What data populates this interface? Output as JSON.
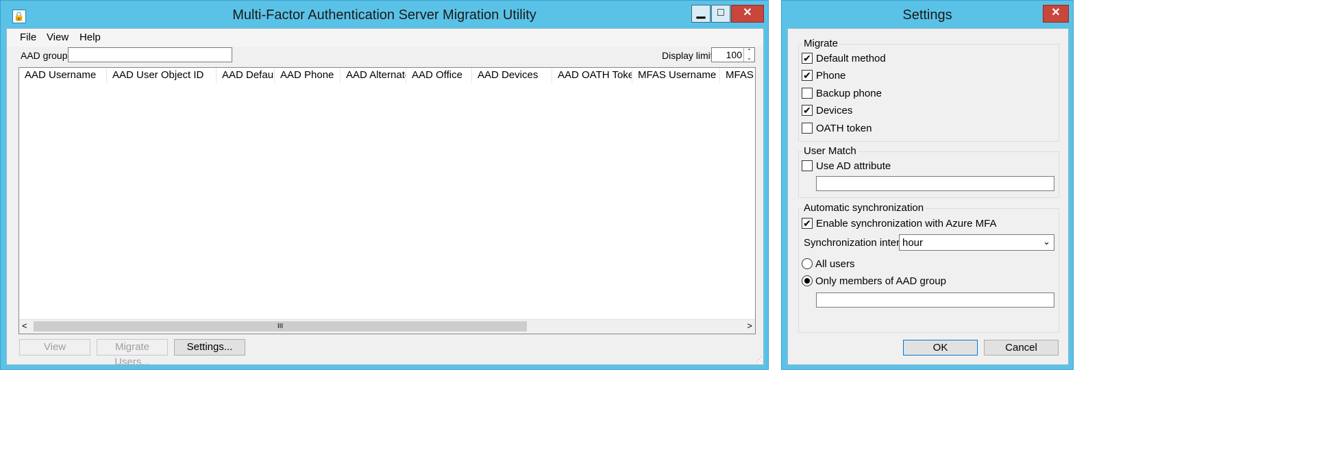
{
  "main_window": {
    "title": "Multi-Factor Authentication Server Migration Utility",
    "controls": {
      "minimize": "▁",
      "maximize": "□",
      "close": "✕"
    },
    "menu": [
      "File",
      "View",
      "Help"
    ],
    "aad_group_label": "AAD group:",
    "aad_group_value": "",
    "display_limit_label": "Display limit:",
    "display_limit_value": "100",
    "columns": [
      "AAD Username",
      "AAD User Object ID",
      "AAD Default",
      "AAD Phone",
      "AAD Alternate",
      "AAD Office",
      "AAD Devices",
      "AAD OATH Token",
      "MFAS Username",
      "MFAS D"
    ],
    "scrollbar": {
      "left": "<",
      "thumb": "III",
      "right": ">"
    },
    "buttons": {
      "view": "View",
      "migrate": "Migrate Users...",
      "settings": "Settings..."
    }
  },
  "settings_window": {
    "title": "Settings",
    "close": "✕",
    "migrate": {
      "title": "Migrate",
      "options": [
        {
          "label": "Default method",
          "checked": true
        },
        {
          "label": "Phone",
          "checked": true
        },
        {
          "label": "Backup phone",
          "checked": false
        },
        {
          "label": "Devices",
          "checked": true
        },
        {
          "label": "OATH token",
          "checked": false
        }
      ]
    },
    "user_match": {
      "title": "User Match",
      "use_ad_attribute": "Use AD attribute",
      "use_ad_checked": false,
      "attribute_value": ""
    },
    "auto_sync": {
      "title": "Automatic synchronization",
      "enable_label": "Enable synchronization with Azure MFA",
      "enable_checked": true,
      "interval_label": "Synchronization interval:",
      "interval_value": "hour",
      "all_users": "All users",
      "only_members": "Only members of AAD group",
      "selected": "only_members",
      "group_value": ""
    },
    "ok": "OK",
    "cancel": "Cancel"
  }
}
